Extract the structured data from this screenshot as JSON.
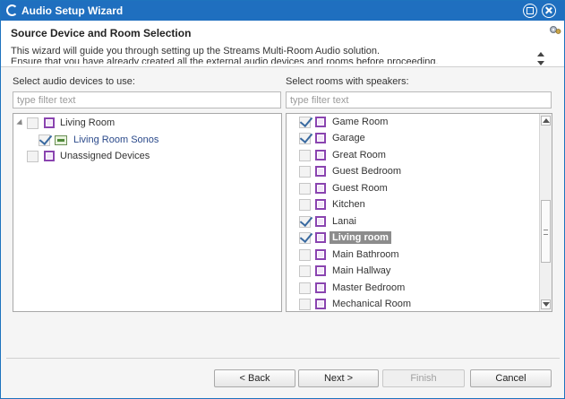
{
  "window": {
    "title": "Audio Setup Wizard"
  },
  "header": {
    "title": "Source Device and Room Selection",
    "description_line1": "This wizard will guide you through setting up the Streams Multi-Room Audio solution.",
    "description_line2": "Ensure that you have already created all the external audio devices and rooms before proceeding."
  },
  "devices_panel": {
    "label": "Select audio devices to use:",
    "filter_placeholder": "type filter text",
    "tree": [
      {
        "label": "Living Room",
        "checked": false,
        "type": "room",
        "expanded": true
      },
      {
        "label": "Living Room Sonos",
        "checked": true,
        "type": "device"
      },
      {
        "label": "Unassigned Devices",
        "checked": false,
        "type": "room"
      }
    ]
  },
  "rooms_panel": {
    "label": "Select rooms with speakers:",
    "filter_placeholder": "type filter text",
    "items": [
      {
        "label": "Game Room",
        "checked": true
      },
      {
        "label": "Garage",
        "checked": true
      },
      {
        "label": "Great Room",
        "checked": false
      },
      {
        "label": "Guest Bedroom",
        "checked": false
      },
      {
        "label": "Guest Room",
        "checked": false
      },
      {
        "label": "Kitchen",
        "checked": false
      },
      {
        "label": "Lanai",
        "checked": true
      },
      {
        "label": "Living room",
        "checked": true,
        "selected": true
      },
      {
        "label": "Main Bathroom",
        "checked": false
      },
      {
        "label": "Main Hallway",
        "checked": false
      },
      {
        "label": "Master Bedroom",
        "checked": false
      },
      {
        "label": "Mechanical Room",
        "checked": false
      }
    ]
  },
  "buttons": {
    "back": "< Back",
    "next": "Next >",
    "finish": "Finish",
    "cancel": "Cancel"
  },
  "colors": {
    "titlebar": "#1f6fbf",
    "room_icon": "#8a44b0",
    "selected_bg": "#8c8c8c"
  }
}
